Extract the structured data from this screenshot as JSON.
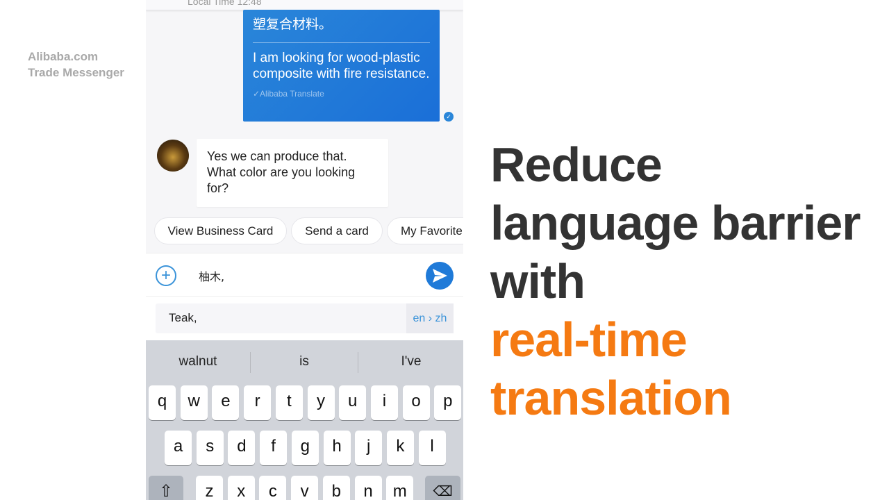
{
  "brand": {
    "line1": "Alibaba.com",
    "line2": "Trade Messenger"
  },
  "chat": {
    "header_local_time": "Local Time 12:48",
    "outgoing": {
      "original": "塑复合材料。",
      "translation": "I am looking for wood-plastic composite with fire resistance.",
      "translated_by": "✓Alibaba Translate",
      "status_icon": "check-circle-icon"
    },
    "incoming": {
      "text": "Yes we can produce that. What color are you looking for?"
    },
    "quick_actions": [
      "View Business Card",
      "Send a card",
      "My Favorite"
    ],
    "input_value": "柚木,",
    "translation_preview": "Teak,",
    "language_pair": "en › zh",
    "accent_color": "#1f7ad8"
  },
  "keyboard": {
    "suggestions": [
      "walnut",
      "is",
      "I've"
    ],
    "row1": [
      "q",
      "w",
      "e",
      "r",
      "t",
      "y",
      "u",
      "i",
      "o",
      "p"
    ],
    "row2": [
      "a",
      "s",
      "d",
      "f",
      "g",
      "h",
      "j",
      "k",
      "l"
    ],
    "row3": [
      "z",
      "x",
      "c",
      "v",
      "b",
      "n",
      "m"
    ]
  },
  "headline": {
    "line1": "Reduce",
    "line2": "language barrier",
    "line3": "with",
    "line4": "real-time",
    "line5": "translation",
    "highlight_color": "#f57a12"
  }
}
